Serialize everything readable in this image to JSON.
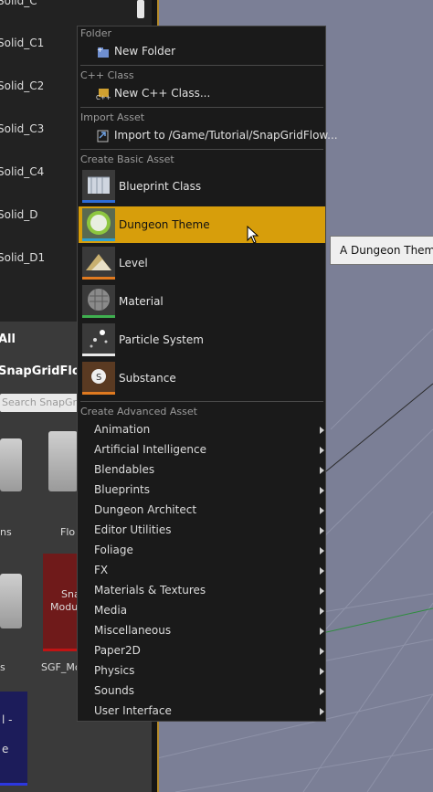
{
  "outliner": {
    "rows": [
      "Solid_C",
      "Solid_C1",
      "Solid_C2",
      "Solid_C3",
      "Solid_C4",
      "Solid_D",
      "Solid_D1"
    ]
  },
  "content_browser": {
    "filter": "All",
    "path": "SnapGridFlow",
    "search_placeholder": "Search SnapGrid",
    "tiles": [
      "ns",
      "Flo",
      "s",
      "SGF_Mo"
    ],
    "sgf_tile_text": [
      "Sna",
      "Modu"
    ],
    "blue_tile_text": [
      "l -",
      "e"
    ]
  },
  "menu": {
    "sections": {
      "folder": "Folder",
      "cpp": "C++ Class",
      "import": "Import Asset",
      "basic": "Create Basic Asset",
      "advanced": "Create Advanced Asset"
    },
    "new_folder": "New Folder",
    "new_cpp": "New C++ Class...",
    "import_to": "Import to /Game/Tutorial/SnapGridFlow...",
    "basic_items": [
      "Blueprint Class",
      "Dungeon Theme",
      "Level",
      "Material",
      "Particle System",
      "Substance"
    ],
    "advanced_items": [
      "Animation",
      "Artificial Intelligence",
      "Blendables",
      "Blueprints",
      "Dungeon Architect",
      "Editor Utilities",
      "Foliage",
      "FX",
      "Materials & Textures",
      "Media",
      "Miscellaneous",
      "Paper2D",
      "Physics",
      "Sounds",
      "User Interface"
    ]
  },
  "tooltip": "A Dungeon Theme",
  "colors": {
    "selected": "#d79e0b",
    "menu_bg": "#1a1a1a",
    "viewport": "#7b7f96"
  }
}
